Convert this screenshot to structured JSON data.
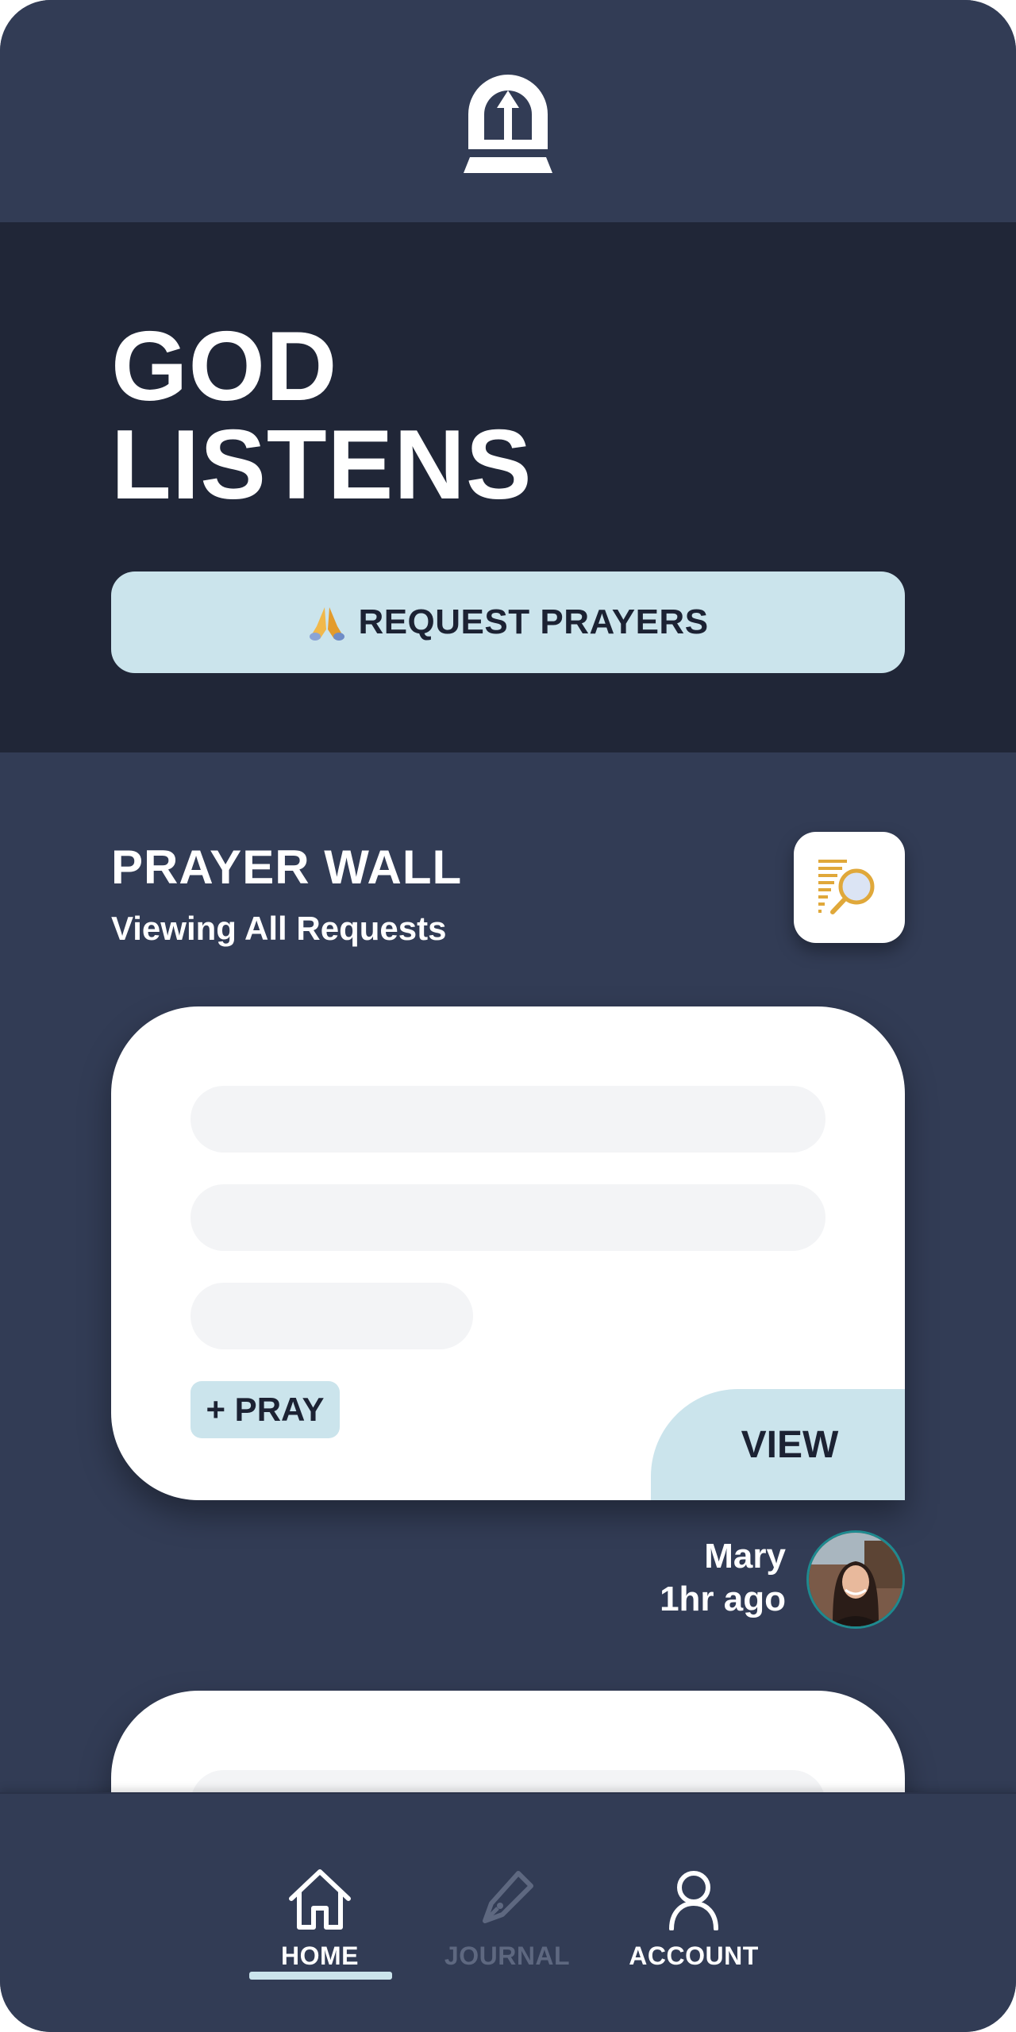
{
  "hero": {
    "title_line1": "GOD",
    "title_line2": "LISTENS",
    "request_label": "REQUEST PRAYERS"
  },
  "wall": {
    "title": "PRAYER WALL",
    "subtitle": "Viewing All Requests"
  },
  "card": {
    "pray_label": "+ PRAY",
    "view_label": "VIEW",
    "author": "Mary",
    "time": "1hr ago"
  },
  "nav": {
    "items": [
      {
        "label": "HOME",
        "icon": "home-icon",
        "state": "active"
      },
      {
        "label": "JOURNAL",
        "icon": "pen-icon",
        "state": "disabled"
      },
      {
        "label": "ACCOUNT",
        "icon": "user-icon",
        "state": "normal"
      }
    ]
  },
  "colors": {
    "background": "#323c55",
    "hero_background": "#202637",
    "accent": "#cbe4ec",
    "nav_disabled": "#5e6880",
    "filter_icon": "#e0a83a"
  }
}
